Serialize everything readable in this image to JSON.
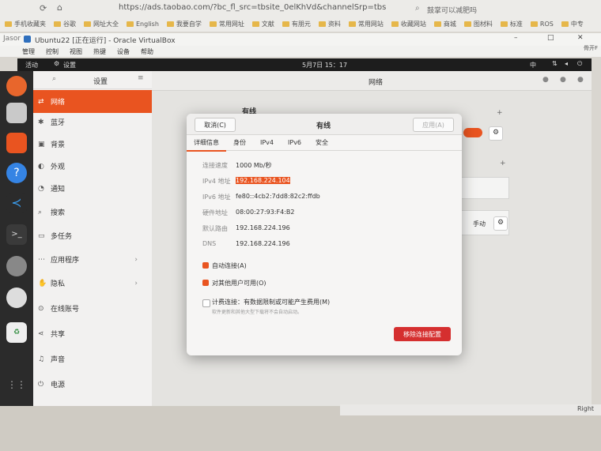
{
  "browser": {
    "url": "https://ads.taobao.com/?bc_fl_src=tbsite_0elKhVd&channelSrp=tbs",
    "search_hint": "鼓掌可以减肥吗",
    "bookmarks": [
      "手机收藏夹",
      "谷歌",
      "网址大全",
      "English",
      "我要自学",
      "常用网址",
      "文献",
      "有朋元",
      "资料",
      "常用网站",
      "收藏网站",
      "商城",
      "图材料",
      "标准",
      "ROS",
      "中专"
    ]
  },
  "vbox": {
    "title": "Ubuntu22 [正在运行] - Oracle VirtualBox",
    "left_label": "Jasor",
    "menu": [
      "管理",
      "控制",
      "视图",
      "热键",
      "设备",
      "帮助"
    ],
    "right_label": "骨开F"
  },
  "ubuntu": {
    "activities": "活动",
    "app_name": "设置",
    "clock": "5月7日  15：17",
    "lang": "中"
  },
  "settings": {
    "title": "设置",
    "panel_title": "网络",
    "items": [
      {
        "icon": "network-icon",
        "label": "网络"
      },
      {
        "icon": "bluetooth-icon",
        "label": "蓝牙"
      },
      {
        "icon": "background-icon",
        "label": "背景"
      },
      {
        "icon": "appearance-icon",
        "label": "外观"
      },
      {
        "icon": "notifications-icon",
        "label": "通知"
      },
      {
        "icon": "search-icon",
        "label": "搜索"
      },
      {
        "icon": "multitask-icon",
        "label": "多任务"
      },
      {
        "icon": "apps-icon",
        "label": "应用程序"
      },
      {
        "icon": "privacy-icon",
        "label": "隐私"
      },
      {
        "icon": "online-accounts-icon",
        "label": "在线账号"
      },
      {
        "icon": "share-icon",
        "label": "共享"
      },
      {
        "icon": "sound-icon",
        "label": "声音"
      },
      {
        "icon": "power-icon",
        "label": "电源"
      }
    ],
    "wired_label": "有线",
    "manual_label": "手动"
  },
  "dialog": {
    "title": "有线",
    "cancel": "取消(C)",
    "apply": "应用(A)",
    "tabs": [
      "详细信息",
      "身份",
      "IPv4",
      "IPv6",
      "安全"
    ],
    "details": [
      {
        "label": "连接速度",
        "value": "1000 Mb/秒"
      },
      {
        "label": "IPv4 地址",
        "value": "192.168.224.104"
      },
      {
        "label": "IPv6 地址",
        "value": "fe80::4cb2:7dd8:82c2:ffdb"
      },
      {
        "label": "硬件地址",
        "value": "08:00:27:93:F4:B2"
      },
      {
        "label": "默认路由",
        "value": "192.168.224.196"
      },
      {
        "label": "DNS",
        "value": "192.168.224.196"
      }
    ],
    "auto_connect": "自动连接(A)",
    "all_users": "对其他用户可用(O)",
    "metered": "计费连接：有数据限制或可能产生费用(M)",
    "metered_note": "软件更新和其他大型下载将不会自动启动。",
    "remove": "移除连接配置"
  },
  "taskbar": {
    "right_text": "Right"
  },
  "colors": {
    "accent": "#e95420",
    "danger": "#d52f2f"
  }
}
